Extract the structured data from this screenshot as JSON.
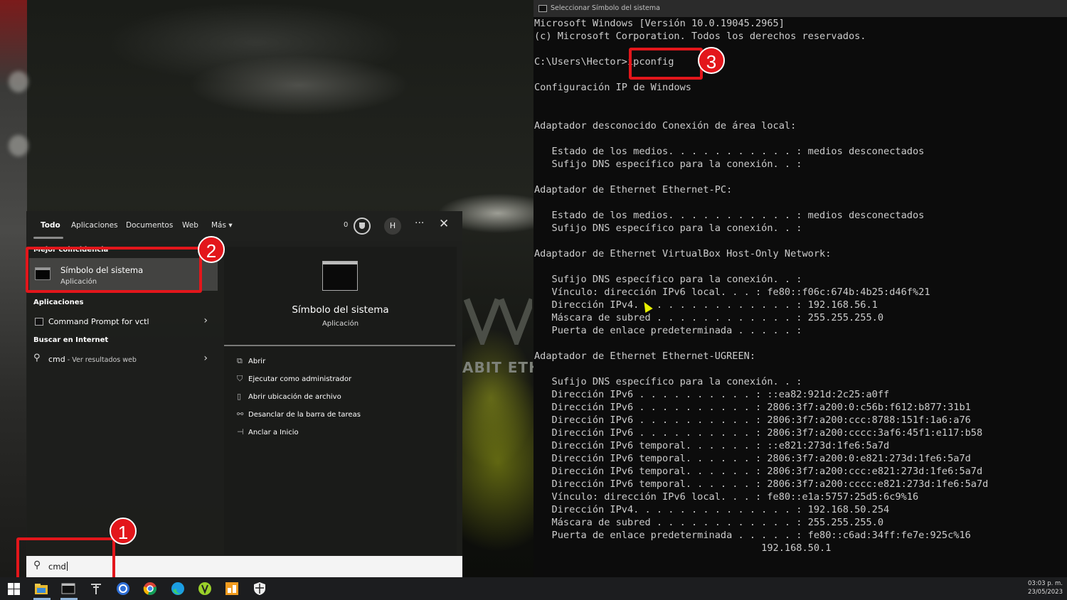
{
  "search": {
    "tabs": [
      {
        "label": "Todo"
      },
      {
        "label": "Aplicaciones"
      },
      {
        "label": "Documentos"
      },
      {
        "label": "Web"
      },
      {
        "label": "Más"
      }
    ],
    "reward_count": "0",
    "avatar_initial": "H",
    "more_glyph": "···",
    "close_glyph": "✕",
    "best_match_label": "Mejor coincidencia",
    "best_match": {
      "title": "Símbolo del sistema",
      "subtitle": "Aplicación"
    },
    "apps_label": "Aplicaciones",
    "app_result": "Command Prompt for vctl",
    "internet_label": "Buscar en Internet",
    "web_query": "cmd",
    "web_suffix": " - Ver resultados web",
    "preview": {
      "title": "Símbolo del sistema",
      "subtitle": "Aplicación",
      "actions": [
        "Abrir",
        "Ejecutar como administrador",
        "Abrir ubicación de archivo",
        "Desanclar de la barra de tareas",
        "Anclar a Inicio"
      ]
    },
    "query": "cmd"
  },
  "console": {
    "title": "Seleccionar Símbolo del sistema",
    "lines": [
      "Microsoft Windows [Versión 10.0.19045.2965]",
      "(c) Microsoft Corporation. Todos los derechos reservados.",
      "",
      "C:\\Users\\Hector>ipconfig",
      "",
      "Configuración IP de Windows",
      "",
      "",
      "Adaptador desconocido Conexión de área local:",
      "",
      "   Estado de los medios. . . . . . . . . . . : medios desconectados",
      "   Sufijo DNS específico para la conexión. . :",
      "",
      "Adaptador de Ethernet Ethernet-PC:",
      "",
      "   Estado de los medios. . . . . . . . . . . : medios desconectados",
      "   Sufijo DNS específico para la conexión. . :",
      "",
      "Adaptador de Ethernet VirtualBox Host-Only Network:",
      "",
      "   Sufijo DNS específico para la conexión. . :",
      "   Vínculo: dirección IPv6 local. . . : fe80::f06c:674b:4b25:d46f%21",
      "   Dirección IPv4. . . . . . . . . . . . . . : 192.168.56.1",
      "   Máscara de subred . . . . . . . . . . . . : 255.255.255.0",
      "   Puerta de enlace predeterminada . . . . . :",
      "",
      "Adaptador de Ethernet Ethernet-UGREEN:",
      "",
      "   Sufijo DNS específico para la conexión. . :",
      "   Dirección IPv6 . . . . . . . . . . : ::ea82:921d:2c25:a0ff",
      "   Dirección IPv6 . . . . . . . . . . : 2806:3f7:a200:0:c56b:f612:b877:31b1",
      "   Dirección IPv6 . . . . . . . . . . : 2806:3f7:a200:ccc:8788:151f:1a6:a76",
      "   Dirección IPv6 . . . . . . . . . . : 2806:3f7:a200:cccc:3af6:45f1:e117:b58",
      "   Dirección IPv6 temporal. . . . . . : ::e821:273d:1fe6:5a7d",
      "   Dirección IPv6 temporal. . . . . . : 2806:3f7:a200:0:e821:273d:1fe6:5a7d",
      "   Dirección IPv6 temporal. . . . . . : 2806:3f7:a200:ccc:e821:273d:1fe6:5a7d",
      "   Dirección IPv6 temporal. . . . . . : 2806:3f7:a200:cccc:e821:273d:1fe6:5a7d",
      "   Vínculo: dirección IPv6 local. . . : fe80::e1a:5757:25d5:6c9%16",
      "   Dirección IPv4. . . . . . . . . . . . . . : 192.168.50.254",
      "   Máscara de subred . . . . . . . . . . . . : 255.255.255.0",
      "   Puerta de enlace predeterminada . . . . . : fe80::c6ad:34ff:fe7e:925c%16",
      "                                       192.168.50.1"
    ]
  },
  "wallpaper_text": "ABIT ETHER",
  "callouts": [
    "1",
    "2",
    "3"
  ],
  "taskbar": {
    "icons": [
      "windows-icon",
      "file-explorer-icon",
      "terminal-icon",
      "tool-icon",
      "app-blue-icon",
      "chrome-icon",
      "edge-icon",
      "app-green-icon",
      "app-orange-icon",
      "shield-icon"
    ],
    "time": "03:03 p. m.",
    "date": "23/05/2023"
  },
  "colors": {
    "annotation": "#e3161b",
    "console_bg": "#0c0c0c",
    "console_text": "#cccccc"
  }
}
